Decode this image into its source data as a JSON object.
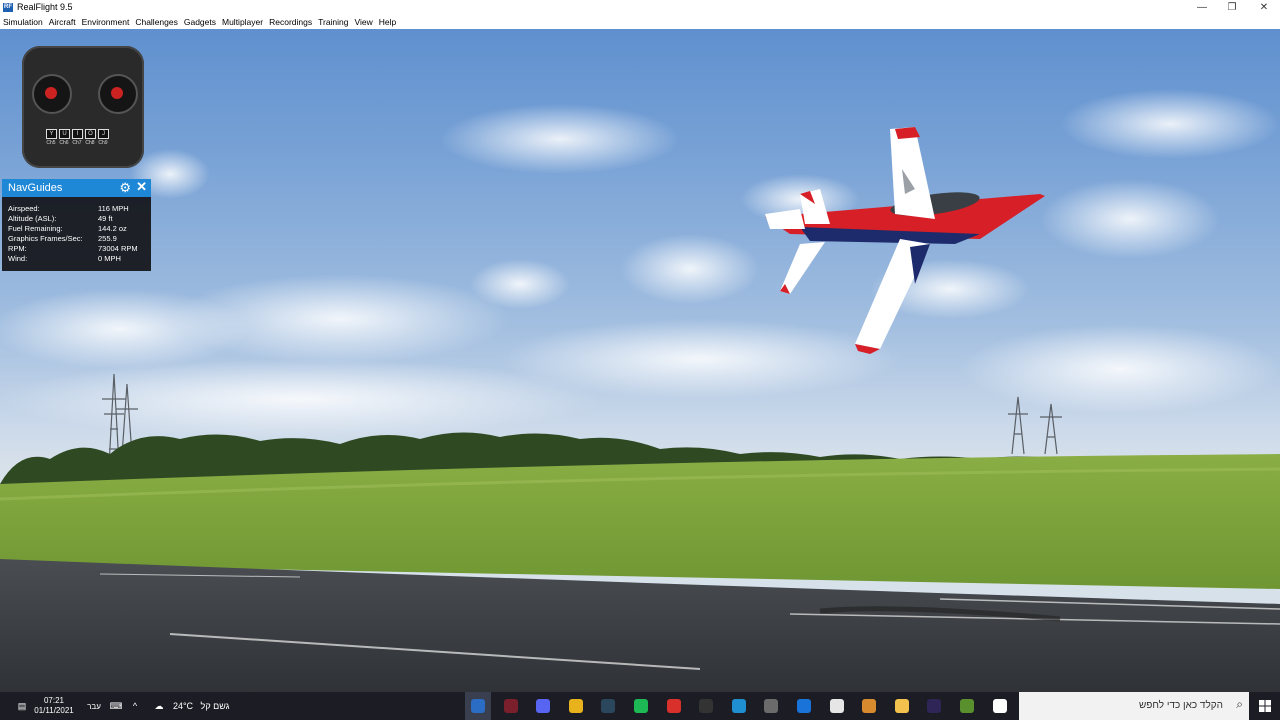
{
  "window": {
    "title": "RealFlight 9.5",
    "app_icon": "RF",
    "controls": {
      "minimize": "—",
      "maximize": "❐",
      "close": "✕"
    }
  },
  "menu": [
    "Simulation",
    "Aircraft",
    "Environment",
    "Challenges",
    "Gadgets",
    "Multiplayer",
    "Recordings",
    "Training",
    "View",
    "Help"
  ],
  "transmitter": {
    "switches": [
      {
        "key": "Y",
        "label": "Ch5"
      },
      {
        "key": "U",
        "label": "Ch6"
      },
      {
        "key": "I",
        "label": "Ch7"
      },
      {
        "key": "O",
        "label": "Ch8"
      },
      {
        "key": "J",
        "label": "Ch9"
      }
    ]
  },
  "navguides": {
    "title": "NavGuides",
    "rows": [
      {
        "label": "Airspeed:",
        "value": "116 MPH"
      },
      {
        "label": "Altitude (ASL):",
        "value": "49 ft"
      },
      {
        "label": "Fuel Remaining:",
        "value": "144.2 oz"
      },
      {
        "label": "Graphics Frames/Sec:",
        "value": "255.9"
      },
      {
        "label": "RPM:",
        "value": "73004 RPM"
      },
      {
        "label": "Wind:",
        "value": "0 MPH"
      }
    ]
  },
  "taskbar": {
    "clock_time": "07:21",
    "clock_date": "01/11/2021",
    "language": "עבר",
    "weather_temp": "24°C",
    "weather_text": "גשם קל",
    "search_placeholder": "הקלד כאן כדי לחפש",
    "apps": [
      {
        "name": "realflight-app-icon",
        "color": "#2b6cc4"
      },
      {
        "name": "vivaldi-app-icon",
        "color": "#7a1f2b"
      },
      {
        "name": "discord-app-icon",
        "color": "#5865f2"
      },
      {
        "name": "chrome-app-icon",
        "color": "#e8b21c"
      },
      {
        "name": "steam-app-icon",
        "color": "#2a475e"
      },
      {
        "name": "spotify-app-icon",
        "color": "#1db954"
      },
      {
        "name": "acrobat-app-icon",
        "color": "#d9302b"
      },
      {
        "name": "epic-games-app-icon",
        "color": "#333333"
      },
      {
        "name": "edge-app-icon",
        "color": "#1f8fd1"
      },
      {
        "name": "chat-app-icon",
        "color": "#6b6b6b"
      },
      {
        "name": "mail-app-icon",
        "color": "#1a73d9"
      },
      {
        "name": "store-app-icon",
        "color": "#e6e6e6"
      },
      {
        "name": "photos-app-icon",
        "color": "#d88a2f"
      },
      {
        "name": "file-explorer-app-icon",
        "color": "#f2c14e"
      },
      {
        "name": "premiere-app-icon",
        "color": "#2f2556"
      },
      {
        "name": "minecraft-app-icon",
        "color": "#5a8f2e"
      },
      {
        "name": "task-view-app-icon",
        "color": "#ffffff"
      }
    ]
  },
  "colors": {
    "sky_top": "#5f90cf",
    "grass": "#7fa33a",
    "runway": "#3a3d42",
    "navguides_header": "#1e88d6",
    "taskbar": "#1c1c24"
  }
}
